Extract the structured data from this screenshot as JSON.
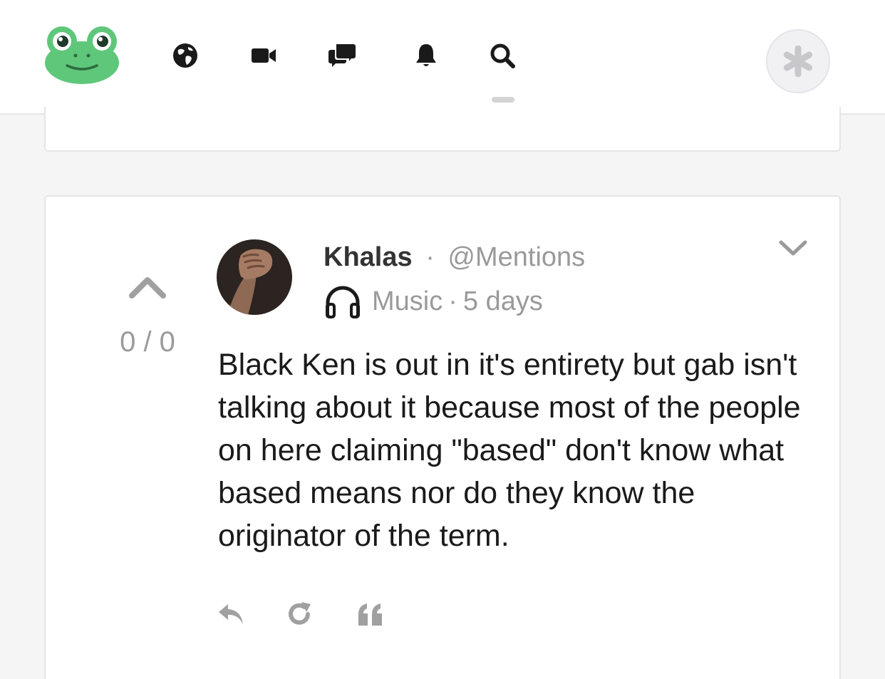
{
  "nav": {
    "logo_icon": "gab-frog-logo",
    "items": [
      {
        "icon": "globe-icon"
      },
      {
        "icon": "video-camera-icon"
      },
      {
        "icon": "chat-bubbles-icon"
      },
      {
        "icon": "bell-icon"
      },
      {
        "icon": "search-icon",
        "active": true
      }
    ],
    "account_icon": "asterisk-icon"
  },
  "post": {
    "score": "0 / 0",
    "author": "Khalas",
    "separator": "·",
    "handle": "@Mentions",
    "topic_icon": "headphones-icon",
    "topic": "Music",
    "time": "5 days",
    "body": "Black Ken is out in it's entirety but gab isn't talking about it because most of the people on here claiming \"based\" don't know what based means nor do they know the originator of the term.",
    "actions": [
      {
        "icon": "reply-icon"
      },
      {
        "icon": "repost-icon"
      },
      {
        "icon": "quote-icon"
      }
    ]
  },
  "colors": {
    "brand_green": "#5fc77a",
    "icon_dark": "#1a1a1a",
    "muted_text": "#9a9a9a",
    "action_gray": "#a0a0a0"
  }
}
